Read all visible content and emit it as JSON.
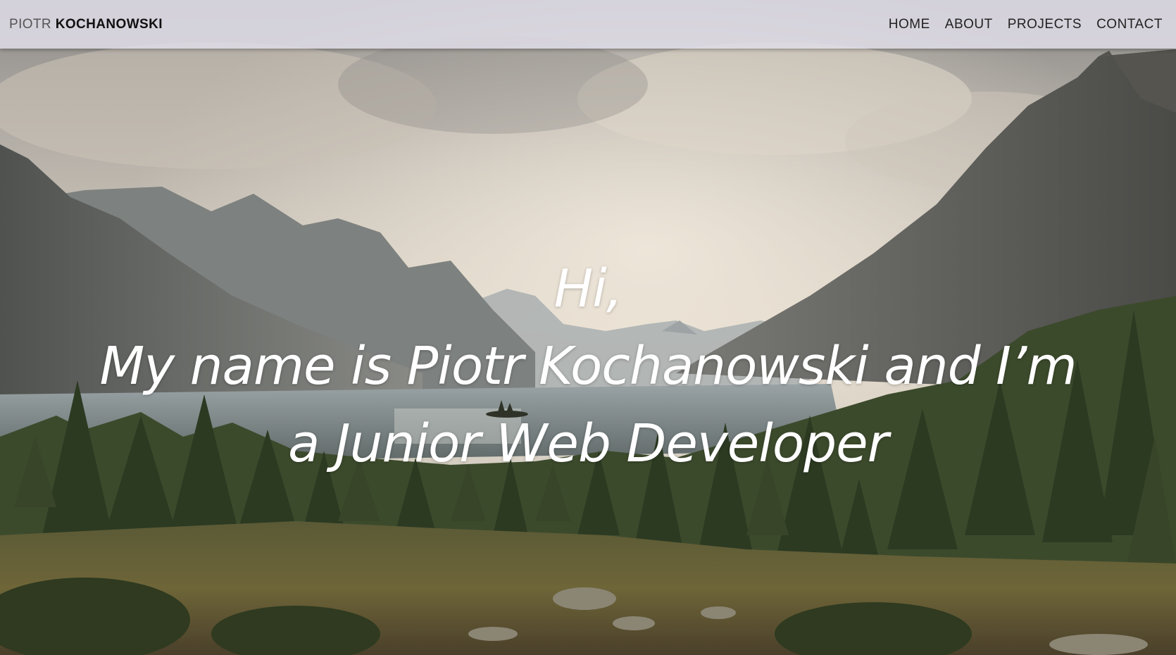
{
  "header": {
    "brand_first": "PIOTR",
    "brand_last": "KOCHANOWSKI",
    "nav": [
      {
        "label": "HOME"
      },
      {
        "label": "ABOUT"
      },
      {
        "label": "PROJECTS"
      },
      {
        "label": "CONTACT"
      }
    ]
  },
  "hero": {
    "line1": "Hi,",
    "line2": "My name is Piotr Kochanowski and I’m",
    "line3": "a Junior Web Developer"
  },
  "colors": {
    "navbar_bg": "#dedce6",
    "hero_text": "#ffffff",
    "sky": "#d8cfc2",
    "forest": "#3c4a2c"
  },
  "background": {
    "subject": "mountain-lake-landscape-photo"
  }
}
